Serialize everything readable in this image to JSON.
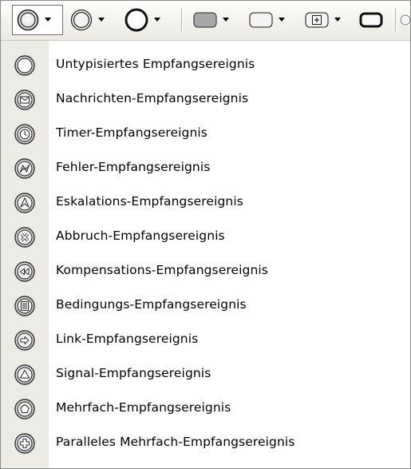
{
  "toolbar": {
    "buttons": [
      {
        "icon": "start-event-untyped-icon",
        "state": "pressed",
        "has_dropdown": true
      },
      {
        "icon": "intermediate-event-icon",
        "has_dropdown": true
      },
      {
        "icon": "end-event-icon",
        "has_dropdown": true
      },
      {
        "icon": "task-icon",
        "has_dropdown": true
      },
      {
        "icon": "subprocess-icon",
        "has_dropdown": true
      },
      {
        "icon": "collapsed-subprocess-icon",
        "has_dropdown": true
      },
      {
        "icon": "call-activity-icon",
        "has_dropdown": true
      }
    ]
  },
  "menu": {
    "items": [
      {
        "label": "Untypisiertes Empfangsereignis",
        "icon": "untyped-catch-event-icon"
      },
      {
        "label": "Nachrichten-Empfangsereignis",
        "icon": "message-catch-event-icon"
      },
      {
        "label": "Timer-Empfangsereignis",
        "icon": "timer-catch-event-icon"
      },
      {
        "label": "Fehler-Empfangsereignis",
        "icon": "error-catch-event-icon"
      },
      {
        "label": "Eskalations-Empfangsereignis",
        "icon": "escalation-catch-event-icon"
      },
      {
        "label": "Abbruch-Empfangsereignis",
        "icon": "cancel-catch-event-icon"
      },
      {
        "label": "Kompensations-Empfangsereignis",
        "icon": "compensation-catch-event-icon"
      },
      {
        "label": "Bedingungs-Empfangsereignis",
        "icon": "conditional-catch-event-icon"
      },
      {
        "label": "Link-Empfangsereignis",
        "icon": "link-catch-event-icon"
      },
      {
        "label": "Signal-Empfangsereignis",
        "icon": "signal-catch-event-icon"
      },
      {
        "label": "Mehrfach-Empfangsereignis",
        "icon": "multiple-catch-event-icon"
      },
      {
        "label": "Paralleles Mehrfach-Empfangsereignis",
        "icon": "parallel-multiple-catch-event-icon"
      }
    ]
  }
}
